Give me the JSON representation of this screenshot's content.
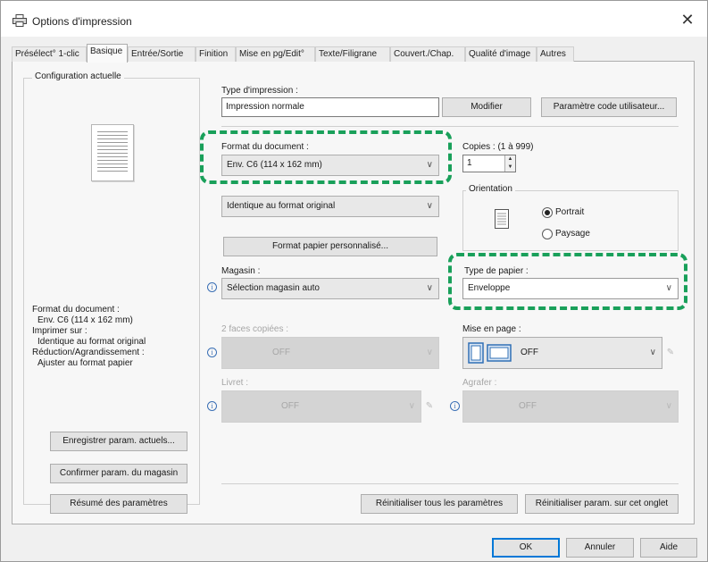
{
  "window": {
    "title": "Options d'impression",
    "close_glyph": "✕",
    "icon": "printer-icon"
  },
  "tabs": [
    {
      "label": "Présélect° 1-clic"
    },
    {
      "label": "Basique",
      "active": true
    },
    {
      "label": "Entrée/Sortie"
    },
    {
      "label": "Finition"
    },
    {
      "label": "Mise en pg/Edit°"
    },
    {
      "label": "Texte/Filigrane"
    },
    {
      "label": "Couvert./Chap."
    },
    {
      "label": "Qualité d'image"
    },
    {
      "label": "Autres"
    }
  ],
  "left": {
    "group_title": "Configuration actuelle",
    "summary": [
      "Format du document :",
      "Env. C6 (114 x 162 mm)",
      "Imprimer sur :",
      "Identique au format original",
      "Réduction/Agrandissement :",
      "Ajuster au format papier"
    ],
    "buttons": {
      "save": "Enregistrer param. actuels...",
      "confirm": "Confirmer param. du magasin",
      "summary": "Résumé des paramètres"
    }
  },
  "print_type": {
    "label": "Type d'impression :",
    "value": "Impression normale",
    "modify": "Modifier",
    "user_code": "Paramètre code utilisateur..."
  },
  "doc_format": {
    "label": "Format du document :",
    "value": "Env. C6 (114 x 162 mm)"
  },
  "print_on": {
    "value": "Identique au format original",
    "custom_button": "Format papier personnalisé..."
  },
  "copies": {
    "label": "Copies : (1 à 999)",
    "value": "1"
  },
  "orientation": {
    "title": "Orientation",
    "portrait": "Portrait",
    "landscape": "Paysage",
    "selected": "portrait"
  },
  "tray": {
    "label": "Magasin :",
    "value": "Sélection magasin auto"
  },
  "paper_type": {
    "label": "Type de papier :",
    "value": "Enveloppe"
  },
  "duplex": {
    "label": "2 faces copiées :",
    "value": "OFF"
  },
  "layout": {
    "label": "Mise en page :",
    "value": "OFF"
  },
  "booklet": {
    "label": "Livret :",
    "value": "OFF"
  },
  "staple": {
    "label": "Agrafer :",
    "value": "OFF"
  },
  "reset": {
    "all": "Réinitialiser tous les paramètres",
    "tab": "Réinitialiser param. sur cet onglet"
  },
  "footer": {
    "ok": "OK",
    "cancel": "Annuler",
    "help": "Aide"
  },
  "colors": {
    "highlight": "#19a05a",
    "accent": "#0078d7"
  }
}
